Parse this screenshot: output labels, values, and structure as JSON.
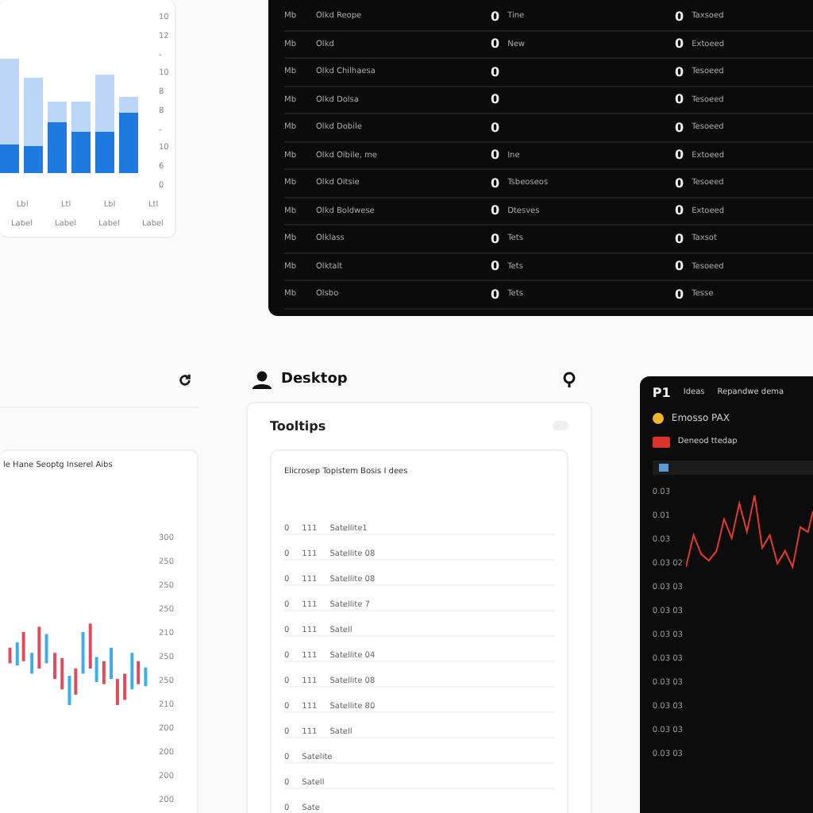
{
  "bar_panel": {
    "y_labels": [
      "10",
      "12",
      "-",
      "10",
      "8",
      "8",
      "-",
      "10",
      "6",
      "0"
    ],
    "x_labels": [
      "Lbl",
      "Ltl",
      "Lbl",
      "Ltl"
    ],
    "x_sublabels": [
      "Label",
      "Label",
      "Label",
      "Label"
    ]
  },
  "table": {
    "rows": [
      {
        "code": "Mb",
        "name": "Olkd Reope",
        "mid_mark": "0",
        "mid": "Tine",
        "right_mark": "0",
        "right": "Taxsoed"
      },
      {
        "code": "Mb",
        "name": "Olkd",
        "mid_mark": "0",
        "mid": "New",
        "right_mark": "0",
        "right": "Extoeed"
      },
      {
        "code": "Mb",
        "name": "Olkd Chilhaesa",
        "mid_mark": "0",
        "mid": "",
        "right_mark": "0",
        "right": "Tesoeed"
      },
      {
        "code": "Mb",
        "name": "Olkd Dolsa",
        "mid_mark": "0",
        "mid": "",
        "right_mark": "0",
        "right": "Tesoeed"
      },
      {
        "code": "Mb",
        "name": "Olkd Dobile",
        "mid_mark": "0",
        "mid": "",
        "right_mark": "0",
        "right": "Tesoeed"
      },
      {
        "code": "Mb",
        "name": "Olkd Oibile, me",
        "mid_mark": "0",
        "mid": "Ine",
        "right_mark": "0",
        "right": "Extoeed"
      },
      {
        "code": "Mb",
        "name": "Olkd Oitsie",
        "mid_mark": "0",
        "mid": "Tsbeoseos",
        "right_mark": "0",
        "right": "Tesoeed"
      },
      {
        "code": "Mb",
        "name": "Olkd Boldwese",
        "mid_mark": "0",
        "mid": "Dtesves",
        "right_mark": "0",
        "right": "Extoeed"
      },
      {
        "code": "Mb",
        "name": "Olklass",
        "mid_mark": "0",
        "mid": "Tets",
        "right_mark": "0",
        "right": "Taxsot"
      },
      {
        "code": "Mb",
        "name": "Olktalt",
        "mid_mark": "0",
        "mid": "Tets",
        "right_mark": "0",
        "right": "Tesoeed"
      },
      {
        "code": "Mb",
        "name": "Olsbo",
        "mid_mark": "0",
        "mid": "Tets",
        "right_mark": "0",
        "right": "Tesse"
      }
    ]
  },
  "candle_panel": {
    "title": "le Hane Seoptg Inserel Aibs",
    "y_labels": [
      "300",
      "250",
      "250",
      "250",
      "210",
      "250",
      "250",
      "210",
      "200",
      "200",
      "200",
      "200"
    ]
  },
  "list_card": {
    "title": "Desktop",
    "subtitle": "Tooltips",
    "caption": "Elicrosep Topistem Bosis I dees",
    "rows": [
      {
        "mark": "0",
        "code": "111",
        "label": "Satellite1"
      },
      {
        "mark": "0",
        "code": "111",
        "label": "Satellite 08"
      },
      {
        "mark": "0",
        "code": "111",
        "label": "Satellite 08"
      },
      {
        "mark": "0",
        "code": "111",
        "label": "Satellite 7"
      },
      {
        "mark": "0",
        "code": "111",
        "label": "Satell"
      },
      {
        "mark": "0",
        "code": "111",
        "label": "Satellite 04"
      },
      {
        "mark": "0",
        "code": "111",
        "label": "Satellite 08"
      },
      {
        "mark": "0",
        "code": "111",
        "label": "Satellite 80"
      },
      {
        "mark": "0",
        "code": "111",
        "label": "Satell"
      },
      {
        "mark": "0",
        "label": "Satelite"
      },
      {
        "mark": "0",
        "label": "Satell"
      },
      {
        "mark": "0",
        "label": "Sate"
      }
    ]
  },
  "dark_panel": {
    "brand": "P1",
    "tab": "Ideas",
    "subtitle": "Repandwe dema",
    "title": "Emosso PAX",
    "badge": "Deneod ttedap",
    "y_labels": [
      "0.03",
      "0.01",
      "0.03",
      "0.03 02",
      "0.03 03",
      "0.03 03",
      "0.03 03",
      "0.03 03",
      "0.03 03",
      "0.03 03",
      "0.03 03",
      "0.03 03"
    ]
  }
}
